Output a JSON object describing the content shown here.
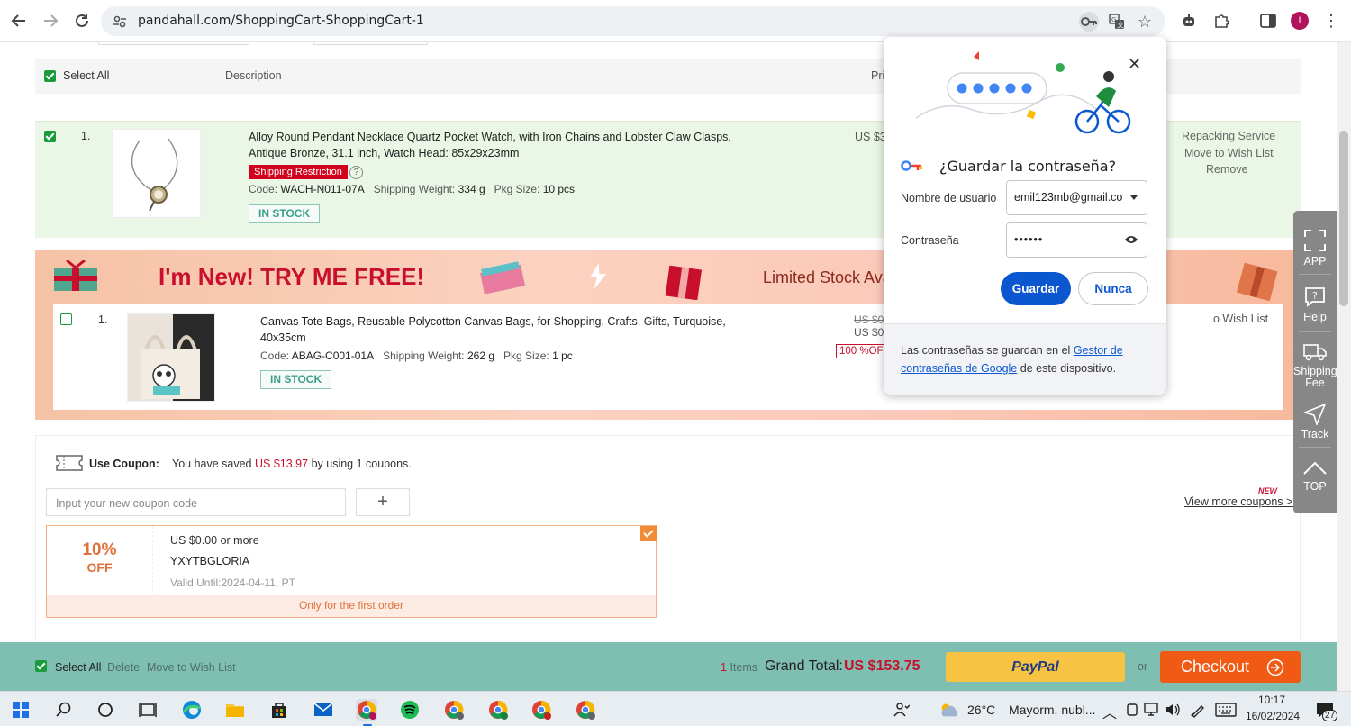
{
  "browser": {
    "url": "pandahall.com/ShoppingCart-ShoppingCart-1",
    "profile_initial": "I"
  },
  "cart": {
    "header": {
      "select_all": "Select All",
      "description": "Description",
      "price_partial": "Pri"
    },
    "item1": {
      "index": "1.",
      "title_line1": "Alloy Round Pendant Necklace Quartz Pocket Watch, with Iron Chains and Lobster Claw Clasps,",
      "title_line2": "Antique Bronze, 31.1 inch, Watch Head: 85x29x23mm",
      "restriction": "Shipping Restriction",
      "code_label": "Code:",
      "code": "WACH-N011-07A",
      "weight_label": "Shipping Weight:",
      "weight": "334 g",
      "pkg_label": "Pkg Size:",
      "pkg": "10 pcs",
      "stock": "IN STOCK",
      "price_partial": "US $3",
      "actions": [
        "Repacking Service",
        "Move to Wish List",
        "Remove"
      ]
    },
    "promo": {
      "title": "I'm New! TRY ME FREE!",
      "subtitle": "Limited Stock Ava",
      "item": {
        "index": "1.",
        "title_line1": "Canvas Tote Bags, Reusable Polycotton Canvas Bags, for Shopping, Crafts, Gifts, Turquoise,",
        "title_line2": "40x35cm",
        "code_label": "Code:",
        "code": "ABAG-C001-01A",
        "weight_label": "Shipping Weight:",
        "weight": "262 g",
        "pkg_label": "Pkg Size:",
        "pkg": "1 pc",
        "stock": "IN STOCK",
        "price_old_partial": "US $0",
        "price_new_partial": "US $0",
        "discount_partial": "100 %OF",
        "wishlist_partial": "o Wish List"
      }
    },
    "coupon": {
      "label": "Use Coupon:",
      "saved_prefix": "You have saved",
      "saved_amount": "US $13.97",
      "saved_suffix": "by using 1 coupons.",
      "input_placeholder": "Input your new coupon code",
      "add_symbol": "+",
      "new_badge": "NEW",
      "more_link": "View more coupons >>",
      "card": {
        "percent": "10%",
        "off": "OFF",
        "condition": "US $0.00 or more",
        "code": "YXYTBGLORIA",
        "valid": "Valid Until:2024-04-11, PT",
        "note": "Only for the first order"
      }
    }
  },
  "bottom_bar": {
    "select_all": "Select All",
    "delete": "Delete",
    "move": "Move to Wish List",
    "items_count": "1",
    "items_label": "Items",
    "grand_total_label": "Grand Total:",
    "grand_total_value": "US $153.75",
    "paypal": "PayPal",
    "or": "or",
    "checkout": "Checkout"
  },
  "side_panel": {
    "app": "APP",
    "help": "Help",
    "shipping_line1": "Shipping",
    "shipping_line2": "Fee",
    "track": "Track",
    "top": "TOP"
  },
  "password_popup": {
    "title": "¿Guardar la contraseña?",
    "username_label": "Nombre de usuario",
    "username_value": "emil123mb@gmail.co",
    "password_label": "Contraseña",
    "password_value": "••••••",
    "save": "Guardar",
    "never": "Nunca",
    "footer_prefix": "Las contraseñas se guardan en el",
    "footer_link": "Gestor de contraseñas de Google",
    "footer_suffix": "de este dispositivo."
  },
  "taskbar": {
    "weather_temp": "26°C",
    "weather_desc": "Mayorm. nubl...",
    "time": "10:17",
    "date": "16/02/2024",
    "notifications": "27"
  },
  "colors": {
    "accent_green": "#1a9c3e",
    "price_red": "#c8102e",
    "checkout_orange": "#f05a14",
    "paypal_yellow": "#f6c342",
    "google_blue": "#0b57d0",
    "bar_teal": "#7fbfb1"
  }
}
